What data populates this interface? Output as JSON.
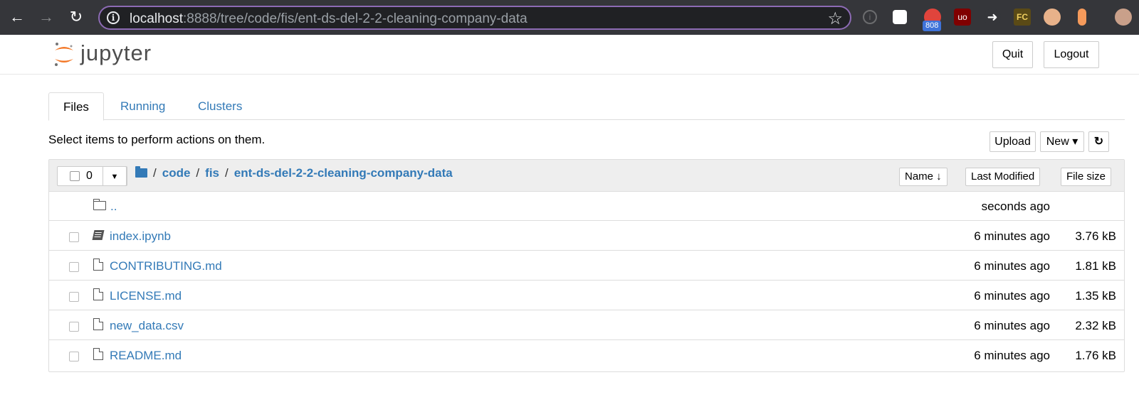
{
  "browser": {
    "url_host": "localhost",
    "url_rest": ":8888/tree/code/fis/ent-ds-del-2-2-cleaning-company-data",
    "ext_badge": "808",
    "ext_fc_label": "FC"
  },
  "header": {
    "logo_text": "jupyter",
    "quit_label": "Quit",
    "logout_label": "Logout"
  },
  "tabs": [
    {
      "label": "Files"
    },
    {
      "label": "Running"
    },
    {
      "label": "Clusters"
    }
  ],
  "toolbar": {
    "hint": "Select items to perform actions on them.",
    "upload_label": "Upload",
    "new_label": "New ▾",
    "refresh_icon": "refresh-icon"
  },
  "list": {
    "selected_count": "0",
    "breadcrumb": [
      "code",
      "fis",
      "ent-ds-del-2-2-cleaning-company-data"
    ],
    "sort_name_label": "Name ↓",
    "sort_modified_label": "Last Modified",
    "sort_size_label": "File size",
    "parent": {
      "name": "..",
      "modified": "seconds ago"
    },
    "rows": [
      {
        "name": "index.ipynb",
        "modified": "6 minutes ago",
        "size": "3.76 kB",
        "icon": "notebook-icon"
      },
      {
        "name": "CONTRIBUTING.md",
        "modified": "6 minutes ago",
        "size": "1.81 kB",
        "icon": "file-icon"
      },
      {
        "name": "LICENSE.md",
        "modified": "6 minutes ago",
        "size": "1.35 kB",
        "icon": "file-icon"
      },
      {
        "name": "new_data.csv",
        "modified": "6 minutes ago",
        "size": "2.32 kB",
        "icon": "file-icon"
      },
      {
        "name": "README.md",
        "modified": "6 minutes ago",
        "size": "1.76 kB",
        "icon": "file-icon"
      }
    ]
  },
  "colors": {
    "link": "#337ab7",
    "chrome_bg": "#35363a",
    "omnibox_border": "#8d6bb5",
    "jupyter_orange": "#f37726"
  }
}
